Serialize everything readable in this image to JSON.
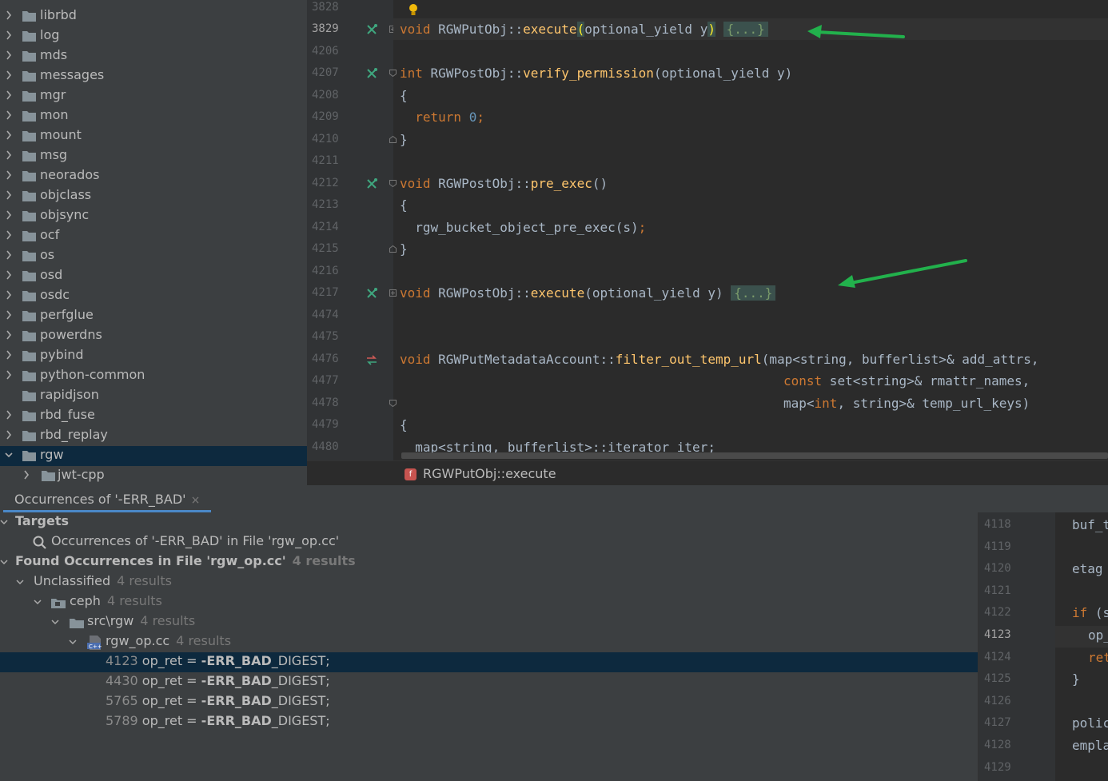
{
  "project_tree": {
    "items": [
      {
        "label": "librbd",
        "expanded": false
      },
      {
        "label": "log",
        "expanded": false
      },
      {
        "label": "mds",
        "expanded": false
      },
      {
        "label": "messages",
        "expanded": false
      },
      {
        "label": "mgr",
        "expanded": false
      },
      {
        "label": "mon",
        "expanded": false
      },
      {
        "label": "mount",
        "expanded": false
      },
      {
        "label": "msg",
        "expanded": false
      },
      {
        "label": "neorados",
        "expanded": false
      },
      {
        "label": "objclass",
        "expanded": false
      },
      {
        "label": "objsync",
        "expanded": false
      },
      {
        "label": "ocf",
        "expanded": false
      },
      {
        "label": "os",
        "expanded": false
      },
      {
        "label": "osd",
        "expanded": false
      },
      {
        "label": "osdc",
        "expanded": false
      },
      {
        "label": "perfglue",
        "expanded": false
      },
      {
        "label": "powerdns",
        "expanded": false
      },
      {
        "label": "pybind",
        "expanded": false
      },
      {
        "label": "python-common",
        "expanded": false
      },
      {
        "label": "rapidjson",
        "expanded": false
      },
      {
        "label": "rbd_fuse",
        "expanded": false
      },
      {
        "label": "rbd_replay",
        "expanded": false
      },
      {
        "label": "rgw",
        "expanded": true,
        "selected": true
      },
      {
        "label": "jwt-cpp",
        "expanded": false,
        "child": true
      }
    ]
  },
  "editor": {
    "line_numbers": [
      "3828",
      "3829",
      "4206",
      "4207",
      "4208",
      "4209",
      "4210",
      "4211",
      "4212",
      "4213",
      "4214",
      "4215",
      "4216",
      "4217",
      "4474",
      "4475",
      "4476",
      "4477",
      "4478",
      "4479",
      "4480"
    ],
    "current_line": "3829",
    "lines": {
      "l3829_kw": "void",
      "l3829_cls": " RGWPutObj::",
      "l3829_fn": "execute",
      "l3829_open": "(",
      "l3829_args": "optional_yield y",
      "l3829_close": ")",
      "l3829_fold": "{...}",
      "l4207_kw": "int",
      "l4207_cls": " RGWPostObj::",
      "l4207_fn": "verify_permission",
      "l4207_args": "(optional_yield y)",
      "l4208": "{",
      "l4209_kw": "return",
      "l4209_num": "0",
      "l4209_end": ";",
      "l4210": "}",
      "l4212_kw": "void",
      "l4212_cls": " RGWPostObj::",
      "l4212_fn": "pre_exec",
      "l4212_args": "()",
      "l4213": "{",
      "l4214_fn": "rgw_bucket_object_pre_exec(s)",
      "l4214_end": ";",
      "l4215": "}",
      "l4217_kw": "void",
      "l4217_cls": " RGWPostObj::",
      "l4217_fn": "execute",
      "l4217_args": "(optional_yield y)",
      "l4217_fold": "{...}",
      "l4476_kw": "void",
      "l4476_cls": " RGWPutMetadataAccount::",
      "l4476_fn": "filter_out_temp_url",
      "l4476_args": "(map<string, bufferlist>& add_attrs,",
      "l4477_kw": "const",
      "l4477_rest": " set<string>& rmattr_names,",
      "l4478_a": "map<",
      "l4478_kw": "int",
      "l4478_b": ", string>& temp_url_keys)",
      "l4479": "{",
      "l4480": "map<string, bufferlist>::iterator iter;"
    }
  },
  "breadcrumb": {
    "badge": "f",
    "text": "RGWPutObj::execute"
  },
  "find_panel": {
    "tab_label": "Occurrences of '-ERR_BAD'",
    "targets_label": "Targets",
    "target_item": "Occurrences of '-ERR_BAD' in File 'rgw_op.cc'",
    "found_label": "Found Occurrences in File 'rgw_op.cc'",
    "found_count": "4 results",
    "unclassified_label": "Unclassified",
    "unclassified_count": "4 results",
    "ceph_label": "ceph",
    "ceph_count": "4 results",
    "srcrgw_label": "src\\rgw",
    "srcrgw_count": "4 results",
    "file_label": "rgw_op.cc",
    "file_count": "4 results",
    "occurrences": [
      {
        "line": "4123",
        "pre": " op_ret = ",
        "match": "-ERR_BAD",
        "post": "_DIGEST;"
      },
      {
        "line": "4430",
        "pre": " op_ret = ",
        "match": "-ERR_BAD",
        "post": "_DIGEST;"
      },
      {
        "line": "5765",
        "pre": " op_ret = ",
        "match": "-ERR_BAD",
        "post": "_DIGEST;"
      },
      {
        "line": "5789",
        "pre": " op_ret = ",
        "match": "-ERR_BAD",
        "post": "_DIGEST;"
      }
    ]
  },
  "preview": {
    "line_numbers": [
      "4118",
      "4119",
      "4120",
      "4121",
      "4122",
      "4123",
      "4124",
      "4125",
      "4126",
      "4127",
      "4128",
      "4129"
    ],
    "current_line": "4123",
    "code": [
      {
        "line": "4118",
        "text": "buf_t"
      },
      {
        "line": "4120",
        "text": "etag"
      },
      {
        "line": "4122",
        "text": "if (s",
        "kw": "if"
      },
      {
        "line": "4123",
        "text": "op_",
        "indent": true
      },
      {
        "line": "4124",
        "text": "ret",
        "indent": true,
        "kw": "ret"
      },
      {
        "line": "4125",
        "text": "}"
      },
      {
        "line": "4127",
        "text": "polic"
      },
      {
        "line": "4128",
        "text": "empla"
      }
    ]
  },
  "colors": {
    "accent": "#4a88c7",
    "selection": "#0d293e",
    "arrow": "#22b14c",
    "keyword": "#cc7832",
    "function": "#ffc66d"
  }
}
